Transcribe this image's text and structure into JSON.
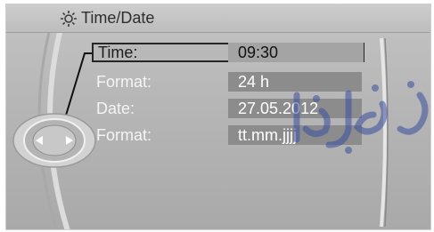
{
  "header": {
    "title": "Time/Date",
    "icon": "gear-icon"
  },
  "controller": {
    "icon": "controller-knob-icon",
    "left_arrow": "arrow-left-icon",
    "right_arrow": "arrow-right-icon"
  },
  "rows": [
    {
      "label": "Time:",
      "value": "09:30",
      "selected": true
    },
    {
      "label": "Format:",
      "value": "24 h",
      "selected": false
    },
    {
      "label": "Date:",
      "value": "27.05.2012",
      "selected": false
    },
    {
      "label": "Format:",
      "value": "tt.mm.jjjj",
      "selected": false
    }
  ],
  "colors": {
    "screen_bg": "#b9b9b9",
    "value_bg": "#8c8c8c",
    "selection_border": "#262626",
    "watermark": "#3a4fa0"
  }
}
